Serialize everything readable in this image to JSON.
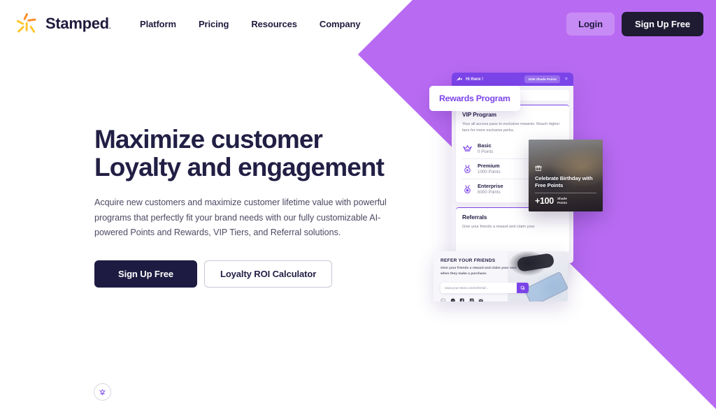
{
  "brand": {
    "name": "Stamped",
    "registered": ".",
    "logo_icon": "stamped-sparkle-logo"
  },
  "nav": {
    "items": [
      {
        "label": "Platform"
      },
      {
        "label": "Pricing"
      },
      {
        "label": "Resources"
      },
      {
        "label": "Company"
      }
    ]
  },
  "header_actions": {
    "login_label": "Login",
    "signup_label": "Sign Up Free"
  },
  "hero": {
    "title_line1": "Maximize customer",
    "title_line2": "Loyalty and engagement",
    "subtitle": "Acquire new customers and maximize customer lifetime value with powerful programs that perfectly fit your brand needs with our fully customizable AI-powered Points and Rewards, VIP Tiers, and Referral solutions.",
    "primary_cta": "Sign Up Free",
    "secondary_cta": "Loyalty ROI Calculator"
  },
  "launcher": {
    "icon": "sparkle-star-icon"
  },
  "mockup": {
    "pill_label": "Rewards Program",
    "widget": {
      "greeting": "Hi there !",
      "points_badge": "3345 Shade Points",
      "close_label": "×",
      "logo_icon": "stamped-mark-icon",
      "vip": {
        "title": "VIP Program",
        "description": "Your all access pass to exclusive rewards. Reach higher tiers for more exclusive perks.",
        "tiers": [
          {
            "name": "Basic",
            "points": "0 Points",
            "icon": "crown-icon"
          },
          {
            "name": "Premium",
            "points": "1000 Points",
            "icon": "medal-star-icon"
          },
          {
            "name": "Enterprise",
            "points": "6000 Points",
            "icon": "medal-plus-icon"
          }
        ]
      },
      "referrals": {
        "title": "Referrals",
        "description": "Give your friends a reward and claim your"
      }
    },
    "promo": {
      "icon": "gift-icon",
      "title": "Celebrate Birthday with Free Points",
      "amount": "+100",
      "amount_unit_line1": "Shade",
      "amount_unit_line2": "Points"
    },
    "refer_card": {
      "title": "REFER YOUR FRIENDS",
      "description": "Give your friends a reward and claim your own when they make a purchase.",
      "url_value": "www.your-store.com/referral/...",
      "copy_icon": "copy-icon",
      "socials": [
        {
          "icon": "whatsapp-icon"
        },
        {
          "icon": "messenger-icon"
        },
        {
          "icon": "facebook-icon"
        },
        {
          "icon": "instagram-icon"
        },
        {
          "icon": "email-icon"
        }
      ]
    }
  },
  "colors": {
    "purple_bg": "#b86bf2",
    "brand_purple": "#7b44e8",
    "dark_navy": "#221f45",
    "logo_orange": "#ff8a1f",
    "logo_yellow": "#ffc526"
  }
}
